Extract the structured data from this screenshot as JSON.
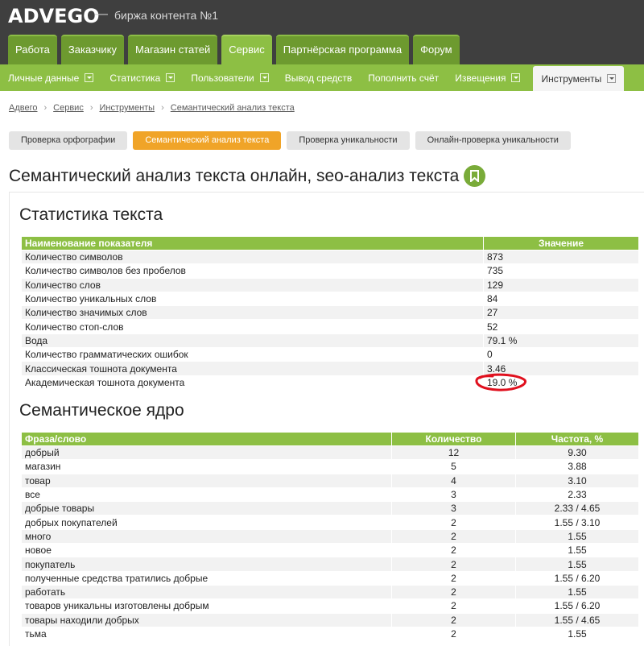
{
  "header": {
    "logo": "ADVEGO",
    "dash": "—",
    "tagline": "биржа контента №1"
  },
  "main_tabs": [
    {
      "label": "Работа",
      "active": false
    },
    {
      "label": "Заказчику",
      "active": false
    },
    {
      "label": "Магазин статей",
      "active": false
    },
    {
      "label": "Сервис",
      "active": true
    },
    {
      "label": "Партнёрская программа",
      "active": false
    },
    {
      "label": "Форум",
      "active": false
    }
  ],
  "sub_nav": [
    {
      "label": "Личные данные",
      "dropdown": true
    },
    {
      "label": "Статистика",
      "dropdown": true
    },
    {
      "label": "Пользователи",
      "dropdown": true
    },
    {
      "label": "Вывод средств",
      "dropdown": false
    },
    {
      "label": "Пополнить счёт",
      "dropdown": false
    },
    {
      "label": "Извещения",
      "dropdown": true
    },
    {
      "label": "Инструменты",
      "dropdown": true,
      "active": true
    }
  ],
  "breadcrumb": [
    "Адвего",
    "Сервис",
    "Инструменты",
    "Семантический анализ текста"
  ],
  "tool_buttons": [
    {
      "label": "Проверка орфографии",
      "active": false
    },
    {
      "label": "Семантический анализ текста",
      "active": true
    },
    {
      "label": "Проверка уникальности",
      "active": false
    },
    {
      "label": "Онлайн-проверка уникальности",
      "active": false
    }
  ],
  "page_title": "Семантический анализ текста онлайн, seo-анализ текста",
  "stats": {
    "title": "Статистика текста",
    "headers": [
      "Наименование показателя",
      "Значение"
    ],
    "rows": [
      [
        "Количество символов",
        "873"
      ],
      [
        "Количество символов без пробелов",
        "735"
      ],
      [
        "Количество слов",
        "129"
      ],
      [
        "Количество уникальных слов",
        "84"
      ],
      [
        "Количество значимых слов",
        "27"
      ],
      [
        "Количество стоп-слов",
        "52"
      ],
      [
        "Вода",
        "79.1 %"
      ],
      [
        "Количество грамматических ошибок",
        "0"
      ],
      [
        "Классическая тошнота документа",
        "3.46"
      ],
      [
        "Академическая тошнота документа",
        "19.0 %"
      ]
    ]
  },
  "core": {
    "title": "Семантическое ядро",
    "headers": [
      "Фраза/слово",
      "Количество",
      "Частота, %"
    ],
    "rows": [
      [
        "добрый",
        "12",
        "9.30"
      ],
      [
        "магазин",
        "5",
        "3.88"
      ],
      [
        "товар",
        "4",
        "3.10"
      ],
      [
        "все",
        "3",
        "2.33"
      ],
      [
        "добрые товары",
        "3",
        "2.33 / 4.65"
      ],
      [
        "добрых покупателей",
        "2",
        "1.55 / 3.10"
      ],
      [
        "много",
        "2",
        "1.55"
      ],
      [
        "новое",
        "2",
        "1.55"
      ],
      [
        "покупатель",
        "2",
        "1.55"
      ],
      [
        "полученные средства тратились добрые",
        "2",
        "1.55 / 6.20"
      ],
      [
        "работать",
        "2",
        "1.55"
      ],
      [
        "товаров уникальны изготовлены добрым",
        "2",
        "1.55 / 6.20"
      ],
      [
        "товары находили добрых",
        "2",
        "1.55 / 4.65"
      ],
      [
        "тьма",
        "2",
        "1.55"
      ]
    ]
  },
  "colors": {
    "header_bg": "#3f3f3f",
    "tab_green": "#6d9a2f",
    "accent_green": "#8dbf44",
    "active_button": "#f0a428",
    "highlight_red": "#e0101e"
  }
}
